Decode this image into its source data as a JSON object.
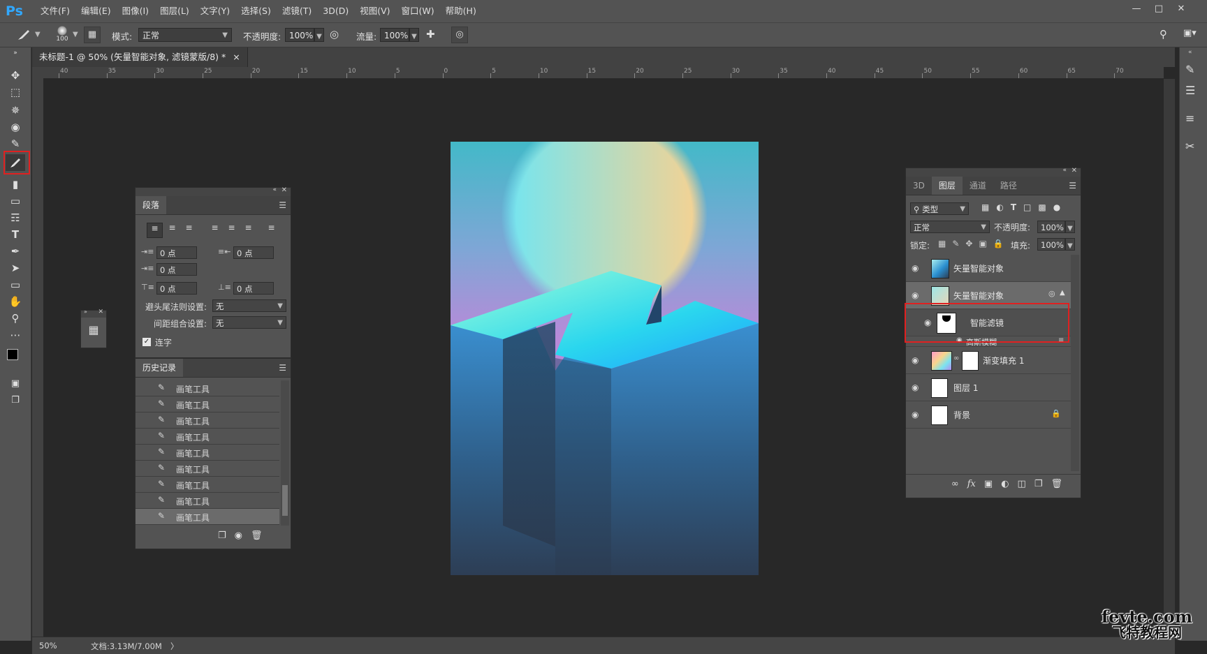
{
  "app": {
    "logo": "Ps",
    "menus": [
      "文件(F)",
      "编辑(E)",
      "图像(I)",
      "图层(L)",
      "文字(Y)",
      "选择(S)",
      "滤镜(T)",
      "3D(D)",
      "视图(V)",
      "窗口(W)",
      "帮助(H)"
    ],
    "window_controls": [
      "minimize-icon",
      "maximize-icon",
      "close-icon"
    ]
  },
  "options": {
    "brush_size": "100",
    "mode_label": "模式:",
    "mode_value": "正常",
    "opacity_label": "不透明度:",
    "opacity_value": "100%",
    "flow_label": "流量:",
    "flow_value": "100%"
  },
  "document": {
    "tab_title": "未标题-1 @ 50% (矢量智能对象, 滤镜蒙版/8) *",
    "close": "×",
    "ruler_ticks": [
      "40",
      "35",
      "30",
      "25",
      "20",
      "15",
      "10",
      "5",
      "0",
      "5",
      "10",
      "15",
      "20",
      "25",
      "30",
      "35",
      "40",
      "45",
      "50",
      "55",
      "60",
      "65",
      "70"
    ]
  },
  "paragraph_panel": {
    "tab": "段落",
    "fields": [
      {
        "value": "0 点"
      },
      {
        "value": "0 点"
      },
      {
        "value": "0 点"
      },
      {
        "value": "0 点"
      },
      {
        "value": "0 点"
      }
    ],
    "kinsoku_label": "避头尾法则设置:",
    "kinsoku_value": "无",
    "mojikumi_label": "间距组合设置:",
    "mojikumi_value": "无",
    "hyphenate_label": "连字",
    "hyphenate_checked": true
  },
  "history_panel": {
    "tab": "历史记录",
    "items": [
      "画笔工具",
      "画笔工具",
      "画笔工具",
      "画笔工具",
      "画笔工具",
      "画笔工具",
      "画笔工具",
      "画笔工具",
      "画笔工具"
    ]
  },
  "layers_panel": {
    "tabs": [
      "3D",
      "图层",
      "通道",
      "路径"
    ],
    "active_tab": "图层",
    "filter_label": "类型",
    "blend_mode": "正常",
    "opacity_label": "不透明度:",
    "opacity_value": "100%",
    "lock_label": "锁定:",
    "fill_label": "填充:",
    "fill_value": "100%",
    "layers": [
      {
        "name": "矢量智能对象"
      },
      {
        "name": "矢量智能对象"
      },
      {
        "name": "智能滤镜"
      },
      {
        "name": "高斯模糊"
      },
      {
        "name": "渐变填充 1"
      },
      {
        "name": "图层 1"
      },
      {
        "name": "背景"
      }
    ],
    "footer_icons": [
      "link-icon",
      "fx-icon",
      "mask-icon",
      "adjustment-icon",
      "folder-icon",
      "new-layer-icon",
      "trash-icon"
    ]
  },
  "status": {
    "zoom": "50%",
    "doc_info": "文档:3.13M/7.00M",
    "arrow": "〉"
  },
  "watermark": {
    "line1": "fevte.com",
    "line2": "飞特教程网"
  },
  "colors": {
    "accent_red": "#e02020",
    "sky_top": "#43b9c8",
    "sky_bottom": "#c084d8",
    "block_light": "#22c6f5",
    "block_dark": "#2c3e55"
  }
}
